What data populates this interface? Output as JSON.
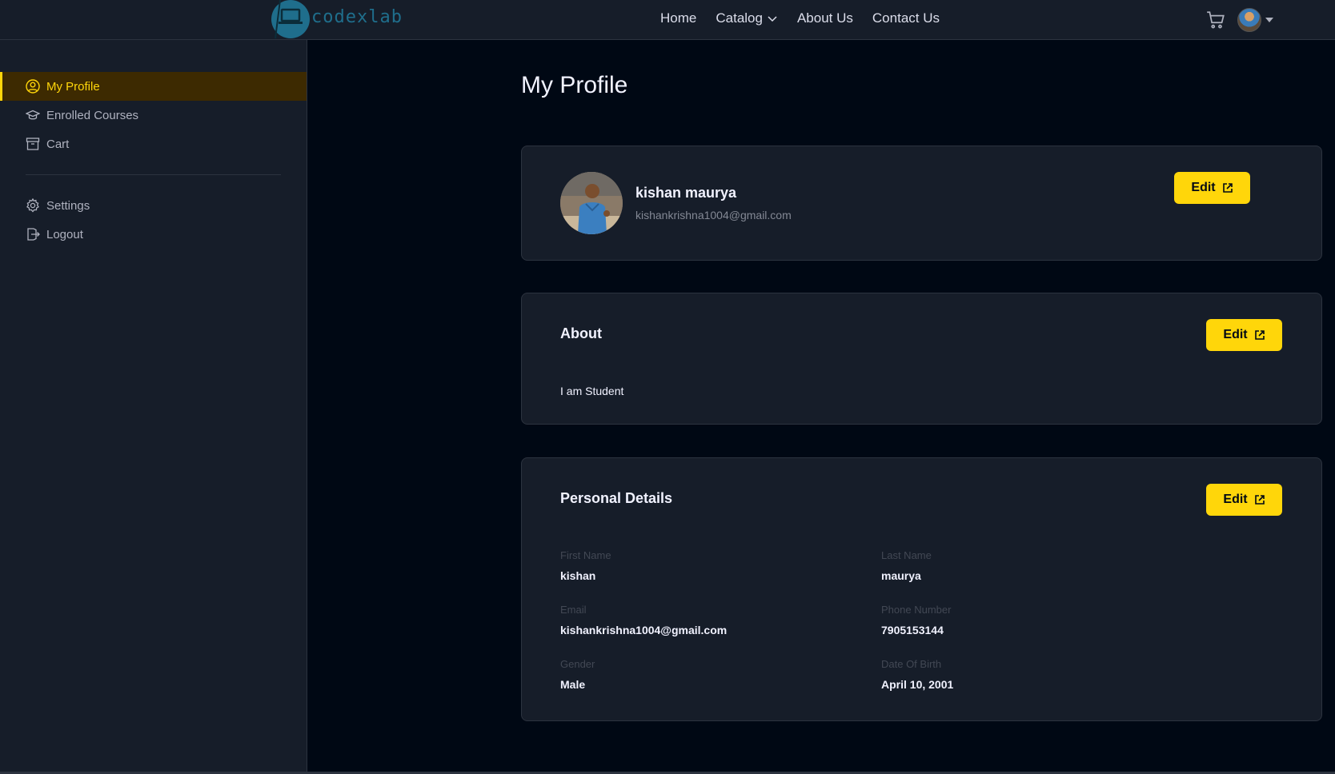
{
  "app": {
    "logo_text": "codexlab"
  },
  "nav": {
    "items": [
      {
        "label": "Home"
      },
      {
        "label": "Catalog"
      },
      {
        "label": "About Us"
      },
      {
        "label": "Contact Us"
      }
    ]
  },
  "sidebar": {
    "items": [
      {
        "label": "My Profile",
        "icon": "user-circle-icon",
        "active": true
      },
      {
        "label": "Enrolled Courses",
        "icon": "graduation-cap-icon"
      },
      {
        "label": "Cart",
        "icon": "archive-box-icon"
      }
    ],
    "bottom_items": [
      {
        "label": "Settings",
        "icon": "gear-icon"
      },
      {
        "label": "Logout",
        "icon": "logout-icon"
      }
    ]
  },
  "page": {
    "title": "My Profile"
  },
  "profile": {
    "name": "kishan maurya",
    "email": "kishankrishna1004@gmail.com",
    "edit_label": "Edit"
  },
  "about": {
    "title": "About",
    "text": "I am Student",
    "edit_label": "Edit"
  },
  "personal": {
    "title": "Personal Details",
    "edit_label": "Edit",
    "fields": [
      {
        "label": "First Name",
        "value": "kishan"
      },
      {
        "label": "Last Name",
        "value": "maurya"
      },
      {
        "label": "Email",
        "value": "kishankrishna1004@gmail.com"
      },
      {
        "label": "Phone Number",
        "value": "7905153144"
      },
      {
        "label": "Gender",
        "value": "Male"
      },
      {
        "label": "Date Of Birth",
        "value": "April 10, 2001"
      }
    ]
  },
  "colors": {
    "accent": "#FFD60A",
    "sidebar_bg": "#161D29",
    "page_bg": "#000814"
  }
}
